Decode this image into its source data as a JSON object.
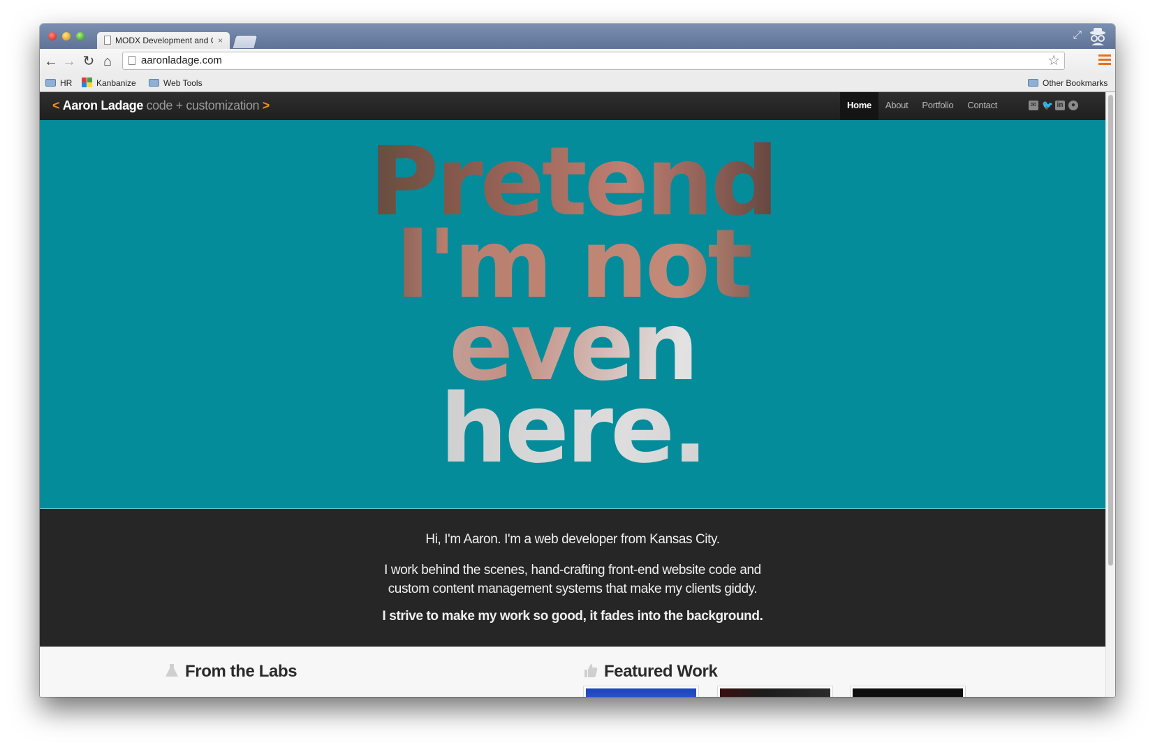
{
  "browser": {
    "tab_title": "MODX Development and C",
    "tab_close": "×",
    "url": "aaronladage.com",
    "bookmarks": [
      "HR",
      "Kanbanize",
      "Web Tools"
    ],
    "other_bookmarks": "Other Bookmarks"
  },
  "site": {
    "brand": {
      "open_bracket": "<",
      "name": "Aaron Ladage",
      "tagline": "code + customization",
      "close_bracket": ">"
    },
    "nav": [
      "Home",
      "About",
      "Portfolio",
      "Contact"
    ],
    "active_nav": "Home",
    "social_icons": [
      "mail-icon",
      "twitter-icon",
      "linkedin-icon",
      "github-icon"
    ]
  },
  "hero": {
    "lines": [
      "Pretend",
      "I'm not",
      "even",
      "here."
    ],
    "background": "#058c9b"
  },
  "intro": {
    "line1": "Hi, I'm Aaron. I'm a web developer from Kansas City.",
    "line2a": "I work behind the scenes, hand-crafting front-end website code and",
    "line2b": "custom content management systems that make my clients giddy.",
    "line3": "I strive to make my work so good, it fades into the background."
  },
  "sections": {
    "labs_title": "From the Labs",
    "featured_title": "Featured Work"
  },
  "colors": {
    "accent": "#f08a1e",
    "nav_bg": "#262626",
    "teal": "#058c9b"
  }
}
